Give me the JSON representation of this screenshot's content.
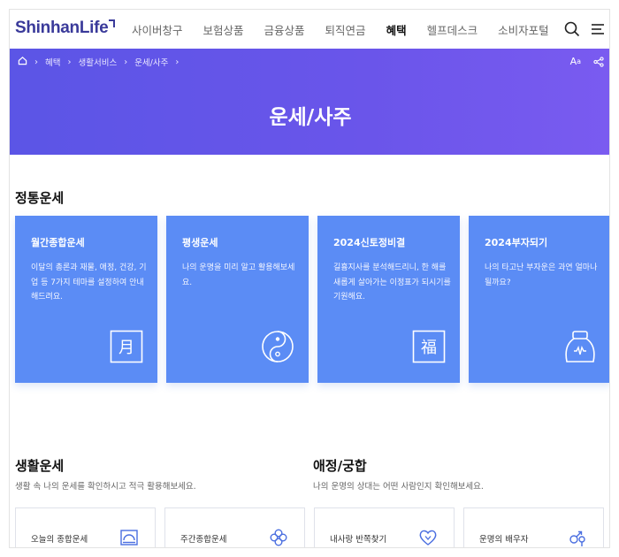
{
  "header": {
    "logo": "ShinhanLife",
    "nav": [
      "사이버창구",
      "보험상품",
      "금융상품",
      "퇴직연금",
      "혜택",
      "헬프데스크",
      "소비자포털"
    ],
    "active_nav": "혜택",
    "search_icon": "search-icon",
    "menu_icon": "hamburger-menu-icon"
  },
  "hero": {
    "breadcrumb": [
      "혜택",
      "생활서비스",
      "운세/사주"
    ],
    "home_icon": "home-icon",
    "title": "운세/사주",
    "font_size_label": "A",
    "font_size_small": "a",
    "share_icon": "share-icon"
  },
  "traditional": {
    "title": "정통운세",
    "cards": [
      {
        "title": "월간종합운세",
        "desc": "이달의 총론과 재물, 애정, 건강, 기업 등 7가지 테마를 설정하여 안내해드려요.",
        "icon": "moon-character-icon",
        "glyph": "月"
      },
      {
        "title": "평생운세",
        "desc": "나의 운명을 미리 알고 활용해보세요.",
        "icon": "yin-yang-icon"
      },
      {
        "title": "2024신토정비결",
        "desc": "길흉지사를 분석해드리니, 한 해를 새롭게 살아가는 이정표가 되시기를 기원해요.",
        "icon": "fortune-character-icon",
        "glyph": "福"
      },
      {
        "title": "2024부자되기",
        "desc": "나의 타고난 부자운은 과연 얼마나 될까요?",
        "icon": "money-bag-icon"
      }
    ]
  },
  "life": {
    "title": "생활운세",
    "sub": "생활 속 나의 운세를 확인하시고 적극 활용해보세요.",
    "items": [
      {
        "label": "오늘의 종합운세",
        "icon": "sunrise-icon"
      },
      {
        "label": "주간종합운세",
        "icon": "clover-icon"
      }
    ]
  },
  "love": {
    "title": "애정/궁합",
    "sub": "나의 운명의 상대는 어떤 사람인지 확인해보세요.",
    "items": [
      {
        "label": "내사랑 반쪽찾기",
        "icon": "heart-icon"
      },
      {
        "label": "운명의 배우자",
        "icon": "couple-symbol-icon"
      }
    ]
  },
  "colors": {
    "brand": "#3a3a9a",
    "hero": "#6a55ea",
    "card": "#5b8cf5"
  }
}
